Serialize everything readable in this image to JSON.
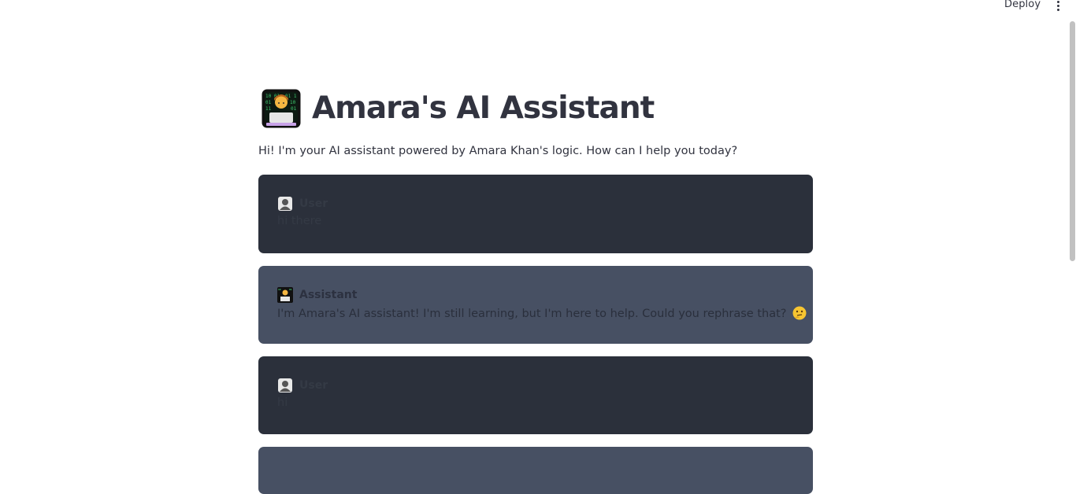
{
  "toolbar": {
    "deploy_label": "Deploy",
    "menu_icon": "vertical-ellipsis-icon"
  },
  "header": {
    "title_icon": "technologist-emoji-icon",
    "title": "Amara's AI Assistant",
    "subtitle": "Hi! I'm your AI assistant powered by Amara Khan's logic. How can I help you today?"
  },
  "chat": {
    "messages": [
      {
        "role": "user",
        "avatar_icon": "user-silhouette-icon",
        "author": "User",
        "text": "hi there"
      },
      {
        "role": "assistant",
        "avatar_icon": "technologist-emoji-icon",
        "author": "Assistant",
        "text": "I'm Amara's AI assistant! I'm still learning, but I'm here to help. Could you rephrase that?",
        "trailing_icon": "thinking-face-emoji-icon"
      },
      {
        "role": "user",
        "avatar_icon": "user-silhouette-icon",
        "author": "User",
        "text": "hi"
      }
    ]
  },
  "colors": {
    "user_bubble": "#2b303b",
    "assistant_bubble": "#475063",
    "text": "#31333f",
    "background": "#ffffff"
  }
}
